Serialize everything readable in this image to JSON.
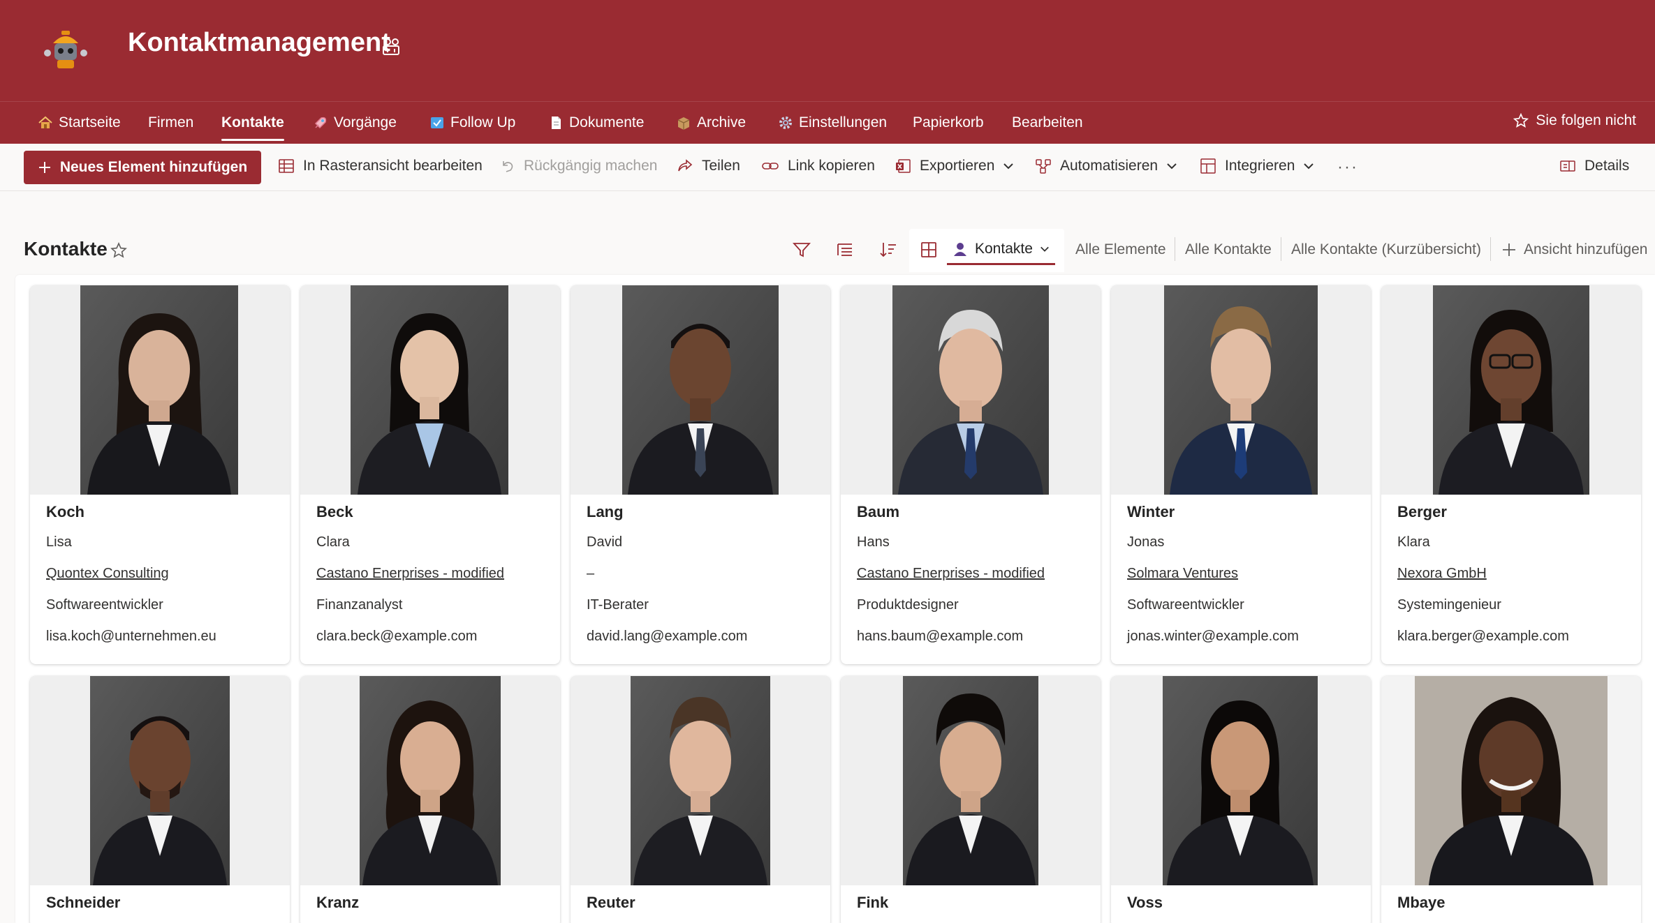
{
  "header": {
    "title": "Kontaktmanagement",
    "logo_icon": "robot-mascot-icon",
    "title_icon": "people-settings-icon",
    "bg_color": "#9a2b32"
  },
  "nav": {
    "items": [
      {
        "label": "Startseite",
        "icon": "home-icon"
      },
      {
        "label": "Firmen"
      },
      {
        "label": "Kontakte",
        "active": true
      },
      {
        "label": "Vorgänge",
        "icon": "rocket-icon"
      },
      {
        "label": "Follow Up",
        "icon": "follow-up-icon"
      },
      {
        "label": "Dokumente",
        "icon": "document-icon"
      },
      {
        "label": "Archive",
        "icon": "box-icon"
      },
      {
        "label": "Einstellungen",
        "icon": "gear-icon"
      },
      {
        "label": "Papierkorb"
      },
      {
        "label": "Bearbeiten"
      }
    ],
    "follow_label": "Sie folgen nicht"
  },
  "commands": {
    "new_item": "Neues Element hinzufügen",
    "grid_edit": "In Rasteransicht bearbeiten",
    "undo": "Rückgängig machen",
    "share": "Teilen",
    "copy_link": "Link kopieren",
    "export": "Exportieren",
    "automate": "Automatisieren",
    "integrate": "Integrieren",
    "more": "···",
    "details": "Details"
  },
  "view": {
    "title": "Kontakte",
    "current_view": "Kontakte",
    "other_views": [
      "Alle Elemente",
      "Alle Kontakte",
      "Alle Kontakte (Kurzübersicht)"
    ],
    "add_view": "Ansicht hinzufügen"
  },
  "cards": [
    {
      "last": "Koch",
      "first": "Lisa",
      "company": "Quontex Consulting",
      "role": "Softwareentwickler",
      "email": "lisa.koch@unternehmen.eu"
    },
    {
      "last": "Beck",
      "first": "Clara",
      "company": "Castano Enerprises - modified",
      "role": "Finanzanalyst",
      "email": "clara.beck@example.com"
    },
    {
      "last": "Lang",
      "first": "David",
      "company": "–",
      "role": "IT-Berater",
      "email": "david.lang@example.com"
    },
    {
      "last": "Baum",
      "first": "Hans",
      "company": "Castano Enerprises - modified",
      "role": "Produktdesigner",
      "email": "hans.baum@example.com"
    },
    {
      "last": "Winter",
      "first": "Jonas",
      "company": "Solmara Ventures",
      "role": "Softwareentwickler",
      "email": "jonas.winter@example.com"
    },
    {
      "last": "Berger",
      "first": "Klara",
      "company": "Nexora GmbH",
      "role": "Systemingenieur",
      "email": "klara.berger@example.com"
    },
    {
      "last": "Schneider"
    },
    {
      "last": "Kranz"
    },
    {
      "last": "Reuter"
    },
    {
      "last": "Fink"
    },
    {
      "last": "Voss"
    },
    {
      "last": "Mbaye"
    }
  ]
}
